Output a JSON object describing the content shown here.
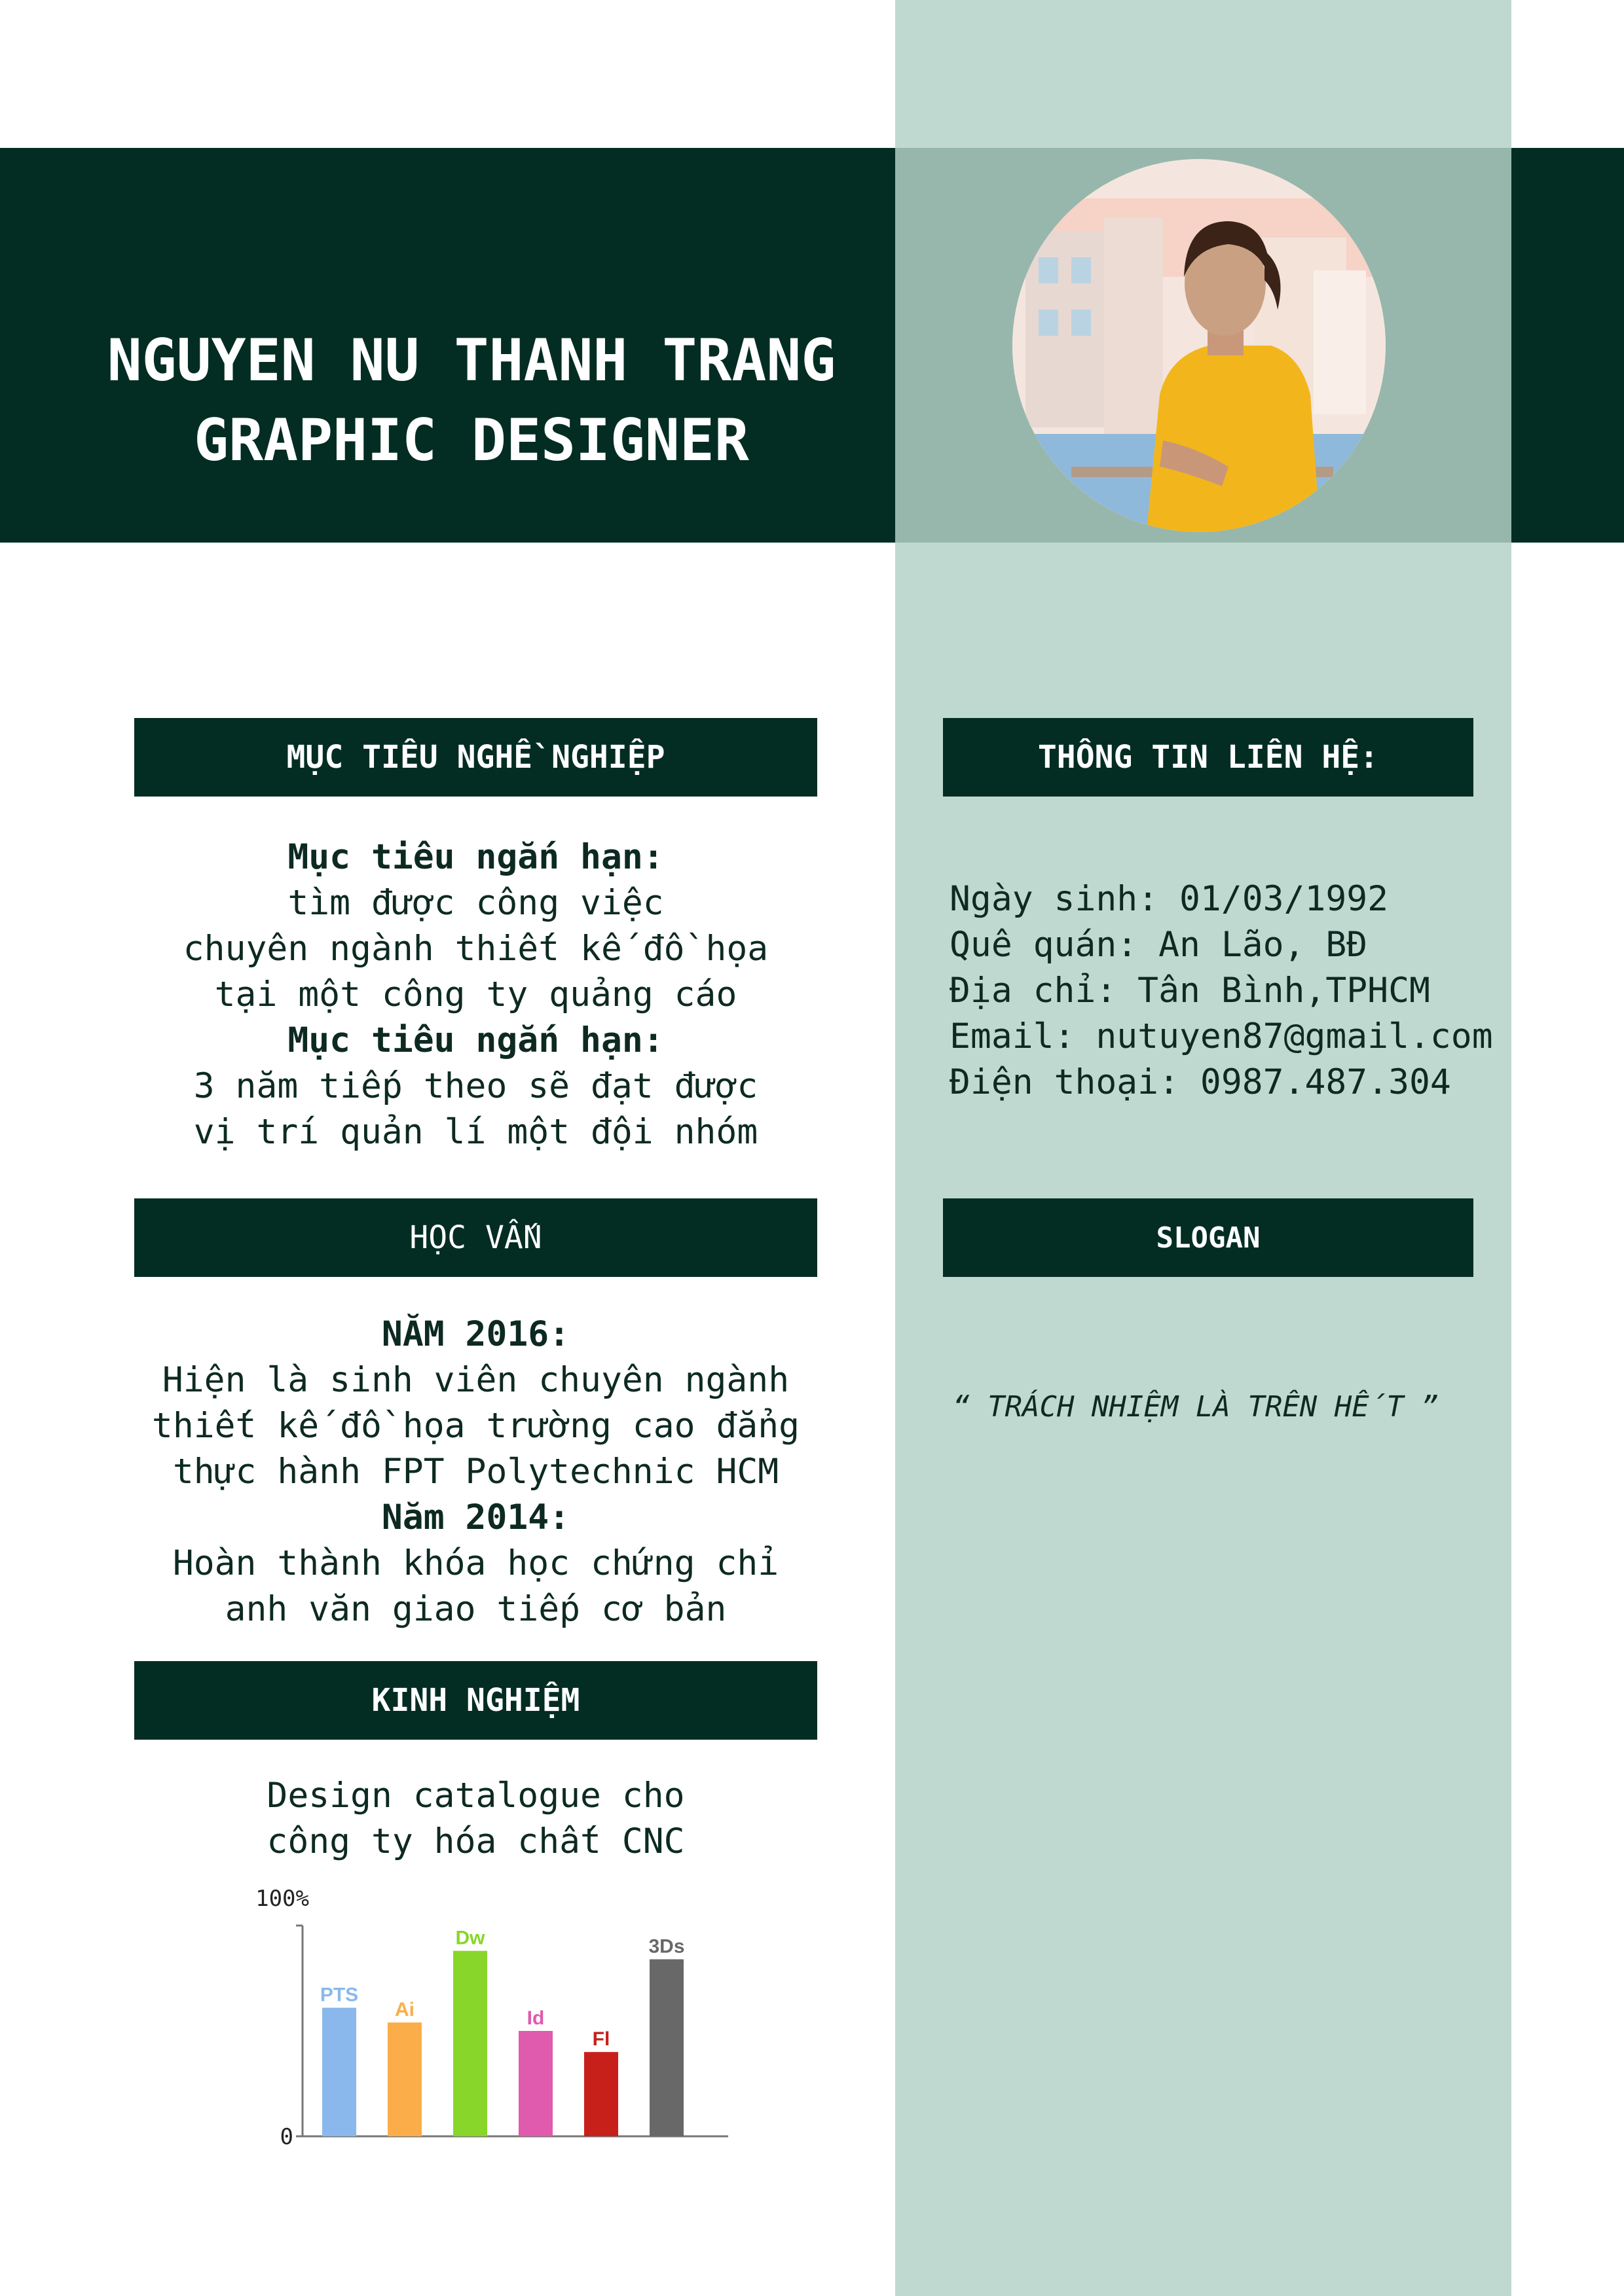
{
  "header": {
    "name": "NGUYEN NU THANH TRANG",
    "job_title": "GRAPHIC DESIGNER"
  },
  "career_objective": {
    "heading": "MỤC TIÊU NGHỀ NGHIỆP",
    "lines": [
      {
        "text": "Mục tiêu ngắn hạn:",
        "bold": true
      },
      {
        "text": "tìm được công việc",
        "bold": false
      },
      {
        "text": "chuyên ngành thiết kế đồ họa",
        "bold": false
      },
      {
        "text": "tại một công ty quảng cáo",
        "bold": false
      },
      {
        "text": "Mục tiêu ngắn hạn:",
        "bold": true
      },
      {
        "text": "3 năm tiếp theo sẽ đạt được",
        "bold": false
      },
      {
        "text": "vị trí quản lí một đội nhóm",
        "bold": false
      }
    ]
  },
  "education": {
    "heading": "HỌC VẤN",
    "lines": [
      {
        "text": "NĂM 2016:",
        "bold": true
      },
      {
        "text": "Hiện là sinh viên chuyên ngành",
        "bold": false
      },
      {
        "text": "thiết kế đồ họa trường cao đẳng",
        "bold": false
      },
      {
        "text": "thực hành FPT Polytechnic HCM",
        "bold": false
      },
      {
        "text": "Năm 2014:",
        "bold": true
      },
      {
        "text": "Hoàn thành khóa học chứng chỉ",
        "bold": false
      },
      {
        "text": "anh văn giao tiếp cơ bản",
        "bold": false
      }
    ]
  },
  "experience": {
    "heading": "KINH NGHIỆM",
    "lines": [
      {
        "text": "Design catalogue cho",
        "bold": false
      },
      {
        "text": "công ty hóa chất CNC",
        "bold": false
      }
    ]
  },
  "contact": {
    "heading": "THÔNG TIN LIÊN HỆ:",
    "lines": [
      "Ngày sinh: 01/03/1992",
      "Quê quán: An Lão, BĐ",
      "Địa chỉ: Tân Bình,TPHCM",
      "Email: nutuyen87@gmail.com",
      "Điện thoại: 0987.487.304"
    ]
  },
  "slogan": {
    "heading": "SLOGAN",
    "text": "“ TRÁCH NHIỆM LÀ TRÊN HẾT ”"
  },
  "chart_data": {
    "type": "bar",
    "categories": [
      "PTS",
      "Ai",
      "Dw",
      "Id",
      "Fl",
      "3Ds"
    ],
    "values": [
      61,
      54,
      88,
      50,
      40,
      84
    ],
    "colors": [
      "#8ab8ec",
      "#fbad4a",
      "#88d62a",
      "#e05aad",
      "#c7201b",
      "#686868"
    ],
    "ylim": [
      0,
      100
    ],
    "y_tick_labels": [
      "0",
      "100%"
    ],
    "title": "",
    "xlabel": "",
    "ylabel": ""
  }
}
